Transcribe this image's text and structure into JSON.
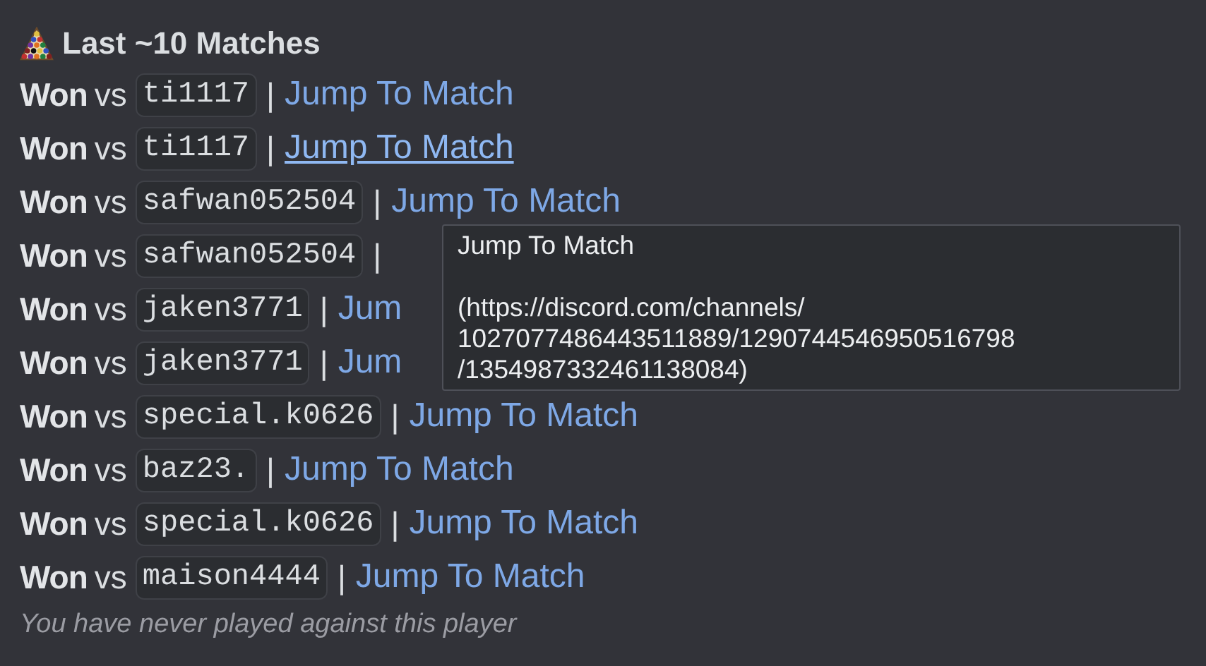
{
  "heading": "Last ~10 Matches",
  "matches": [
    {
      "result": "Won",
      "vs": "vs",
      "opponent": "ti1117",
      "separator": "|",
      "link": "Jump To Match",
      "hovered": false
    },
    {
      "result": "Won",
      "vs": "vs",
      "opponent": "ti1117",
      "separator": "|",
      "link": "Jump To Match",
      "hovered": true
    },
    {
      "result": "Won",
      "vs": "vs",
      "opponent": "safwan052504",
      "separator": "|",
      "link": "Jump To Match",
      "hovered": false
    },
    {
      "result": "Won",
      "vs": "vs",
      "opponent": "safwan052504",
      "separator": "|"
    },
    {
      "result": "Won",
      "vs": "vs",
      "opponent": "jaken3771",
      "separator": "|",
      "link": "Jum",
      "hovered": false
    },
    {
      "result": "Won",
      "vs": "vs",
      "opponent": "jaken3771",
      "separator": "|",
      "link": "Jum",
      "hovered": false
    },
    {
      "result": "Won",
      "vs": "vs",
      "opponent": "special.k0626",
      "separator": "|",
      "link": "Jump To Match",
      "hovered": false
    },
    {
      "result": "Won",
      "vs": "vs",
      "opponent": "baz23.",
      "separator": "|",
      "link": "Jump To Match",
      "hovered": false
    },
    {
      "result": "Won",
      "vs": "vs",
      "opponent": "special.k0626",
      "separator": "|",
      "link": "Jump To Match",
      "hovered": false
    },
    {
      "result": "Won",
      "vs": "vs",
      "opponent": "maison4444",
      "separator": "|",
      "link": "Jump To Match",
      "hovered": false
    }
  ],
  "footer": "You have never played against this player",
  "tooltip": {
    "title": "Jump To Match",
    "lines": [
      "(https://discord.com/channels/",
      "1027077486443511889/1290744546950516798",
      "/1354987332461138084)"
    ]
  }
}
